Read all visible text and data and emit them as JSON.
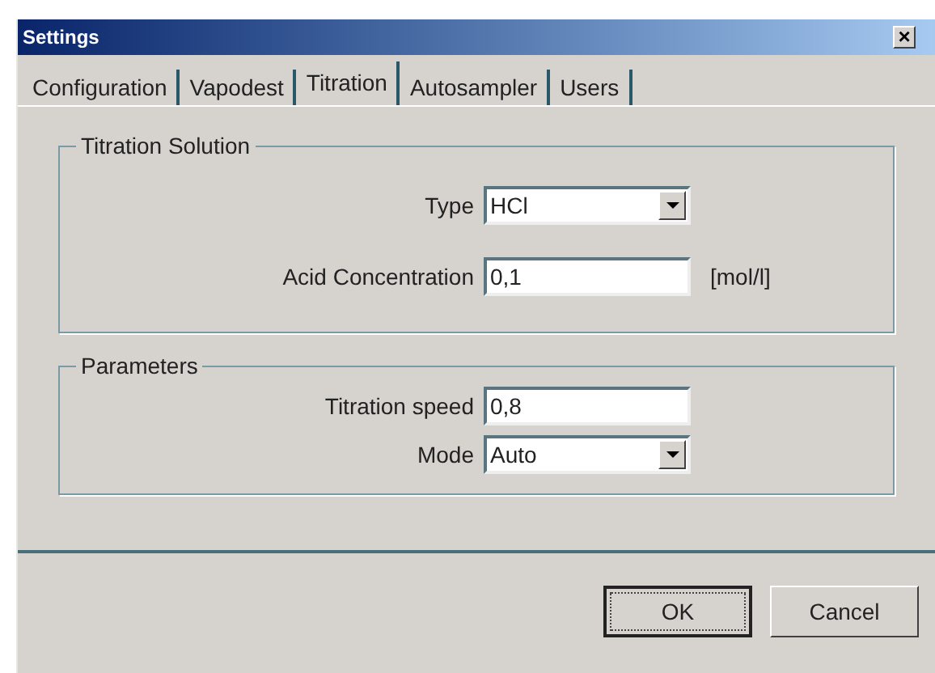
{
  "window": {
    "title": "Settings",
    "close": "×"
  },
  "tabs": [
    {
      "label": "Configuration",
      "selected": false
    },
    {
      "label": "Vapodest",
      "selected": false
    },
    {
      "label": "Titration",
      "selected": true
    },
    {
      "label": "Autosampler",
      "selected": false
    },
    {
      "label": "Users",
      "selected": false
    }
  ],
  "groups": [
    {
      "title": "Titration Solution",
      "rows": [
        {
          "kind": "dropdown",
          "label": "Type",
          "value": "HCl"
        },
        {
          "kind": "text",
          "label": "Acid Concentration",
          "value": "0,1",
          "unit": "[mol/l]"
        }
      ]
    },
    {
      "title": "Parameters",
      "rows": [
        {
          "kind": "text",
          "label": "Titration speed",
          "value": "0,8"
        },
        {
          "kind": "dropdown",
          "label": "Mode",
          "value": "Auto"
        }
      ]
    }
  ],
  "buttons": [
    {
      "label": "OK",
      "default": true
    },
    {
      "label": "Cancel",
      "default": false
    }
  ]
}
